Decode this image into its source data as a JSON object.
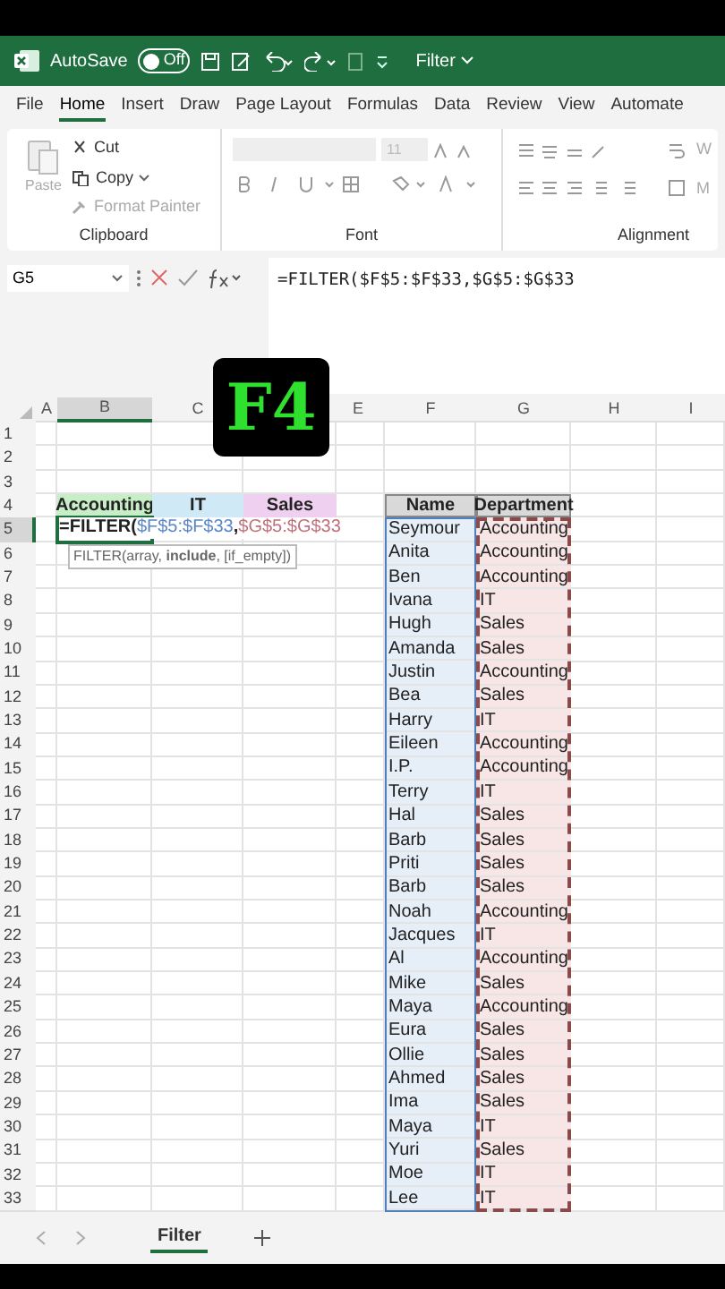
{
  "title_bar": {
    "autosave_label": "AutoSave",
    "autosave_toggle": {
      "label": "Off",
      "on": false
    },
    "file_name": "Filter"
  },
  "menu_tabs": [
    {
      "label": "File",
      "selected": false
    },
    {
      "label": "Home",
      "selected": true
    },
    {
      "label": "Insert",
      "selected": false
    },
    {
      "label": "Draw",
      "selected": false
    },
    {
      "label": "Page Layout",
      "selected": false
    },
    {
      "label": "Formulas",
      "selected": false
    },
    {
      "label": "Data",
      "selected": false
    },
    {
      "label": "Review",
      "selected": false
    },
    {
      "label": "View",
      "selected": false
    },
    {
      "label": "Automate",
      "selected": false
    }
  ],
  "ribbon": {
    "clipboard": {
      "paste": "Paste",
      "cut": "Cut",
      "copy": "Copy",
      "format_painter": "Format Painter",
      "label": "Clipboard"
    },
    "font": {
      "size": "11",
      "label": "Font"
    },
    "alignment": {
      "wrap": "W",
      "merge": "M",
      "label": "Alignment"
    }
  },
  "name_box": "G5",
  "formula": "=FILTER($F$5:$F$33,$G$5:$G$33",
  "key_badge": "F4",
  "columns": [
    {
      "label": "A",
      "selected": false
    },
    {
      "label": "B",
      "selected": true
    },
    {
      "label": "C",
      "selected": false
    },
    {
      "label": "E",
      "selected": false
    },
    {
      "label": "F",
      "selected": false
    },
    {
      "label": "G",
      "selected": false
    },
    {
      "label": "H",
      "selected": false
    },
    {
      "label": "I",
      "selected": false
    }
  ],
  "rows": [
    {
      "label": "1",
      "selected": false
    },
    {
      "label": "2",
      "selected": false
    },
    {
      "label": "3",
      "selected": false
    },
    {
      "label": "4",
      "selected": false
    },
    {
      "label": "5",
      "selected": true
    },
    {
      "label": "6",
      "selected": false
    },
    {
      "label": "7",
      "selected": false
    },
    {
      "label": "8",
      "selected": false
    },
    {
      "label": "9",
      "selected": false
    },
    {
      "label": "10",
      "selected": false
    },
    {
      "label": "11",
      "selected": false
    },
    {
      "label": "12",
      "selected": false
    },
    {
      "label": "13",
      "selected": false
    },
    {
      "label": "14",
      "selected": false
    },
    {
      "label": "15",
      "selected": false
    },
    {
      "label": "16",
      "selected": false
    },
    {
      "label": "17",
      "selected": false
    },
    {
      "label": "18",
      "selected": false
    },
    {
      "label": "19",
      "selected": false
    },
    {
      "label": "20",
      "selected": false
    },
    {
      "label": "21",
      "selected": false
    },
    {
      "label": "22",
      "selected": false
    },
    {
      "label": "23",
      "selected": false
    },
    {
      "label": "24",
      "selected": false
    },
    {
      "label": "25",
      "selected": false
    },
    {
      "label": "26",
      "selected": false
    },
    {
      "label": "27",
      "selected": false
    },
    {
      "label": "28",
      "selected": false
    },
    {
      "label": "29",
      "selected": false
    },
    {
      "label": "30",
      "selected": false
    },
    {
      "label": "31",
      "selected": false
    },
    {
      "label": "32",
      "selected": false
    },
    {
      "label": "33",
      "selected": false
    }
  ],
  "category_headers": [
    {
      "label": "Accounting",
      "color": "#c8eec8"
    },
    {
      "label": "IT",
      "color": "#cfe9f7"
    },
    {
      "label": "Sales",
      "color": "#f0d0f0"
    }
  ],
  "editing_cell": [
    {
      "text": "=FILTER(",
      "kind": "plain"
    },
    {
      "text": "$F$5:$F$33",
      "kind": "ref",
      "color": "#5b86c6"
    },
    {
      "text": ",",
      "kind": "plain"
    },
    {
      "text": "$G$5:$G$33",
      "kind": "ref",
      "color": "#c0707a"
    }
  ],
  "tooltip": "FILTER(array, **include**, [if_empty])",
  "table": {
    "columns": [
      "Name",
      "Department"
    ],
    "rows": [
      [
        "Seymour",
        "Accounting"
      ],
      [
        "Anita",
        "Accounting"
      ],
      [
        "Ben",
        "Accounting"
      ],
      [
        "Ivana",
        "IT"
      ],
      [
        "Hugh",
        "Sales"
      ],
      [
        "Amanda",
        "Sales"
      ],
      [
        "Justin",
        "Accounting"
      ],
      [
        "Bea",
        "Sales"
      ],
      [
        "Harry",
        "IT"
      ],
      [
        "Eileen",
        "Accounting"
      ],
      [
        "I.P.",
        "Accounting"
      ],
      [
        "Terry",
        "IT"
      ],
      [
        "Hal",
        "Sales"
      ],
      [
        "Barb",
        "Sales"
      ],
      [
        "Priti",
        "Sales"
      ],
      [
        "Barb",
        "Sales"
      ],
      [
        "Noah",
        "Accounting"
      ],
      [
        "Jacques",
        "IT"
      ],
      [
        "Al",
        "Accounting"
      ],
      [
        "Mike",
        "Sales"
      ],
      [
        "Maya",
        "Accounting"
      ],
      [
        "Eura",
        "Sales"
      ],
      [
        "Ollie",
        "Sales"
      ],
      [
        "Ahmed",
        "Sales"
      ],
      [
        "Ima",
        "Sales"
      ],
      [
        "Maya",
        "IT"
      ],
      [
        "Yuri",
        "Sales"
      ],
      [
        "Moe",
        "IT"
      ],
      [
        "Lee",
        "IT"
      ]
    ]
  },
  "sheet_tabs": [
    {
      "label": "Filter",
      "selected": true
    }
  ]
}
